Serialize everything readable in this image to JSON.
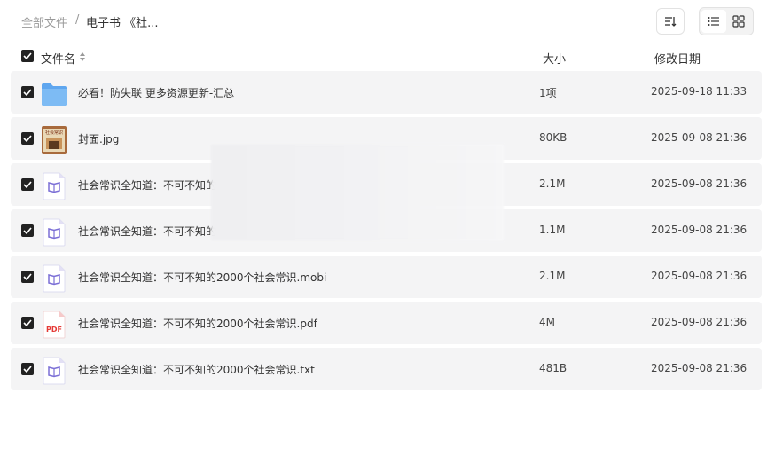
{
  "breadcrumb": {
    "root": "全部文件",
    "separator": "/",
    "current": "电子书 《社..."
  },
  "columns": {
    "name": "文件名",
    "size": "大小",
    "modified": "修改日期"
  },
  "files": [
    {
      "name": "必看！防失联 更多资源更新-汇总",
      "size": "1项",
      "modified": "2025-09-18 11:33",
      "icon": "folder-icon"
    },
    {
      "name": "封面.jpg",
      "size": "80KB",
      "modified": "2025-09-08 21:36",
      "icon": "image-thumbnail-icon"
    },
    {
      "name": "社会常识全知道：不可不知的",
      "size": "2.1M",
      "modified": "2025-09-08 21:36",
      "icon": "ebook-icon"
    },
    {
      "name": "社会常识全知道：不可不知的",
      "size": "1.1M",
      "modified": "2025-09-08 21:36",
      "icon": "ebook-icon"
    },
    {
      "name": "社会常识全知道：不可不知的2000个社会常识.mobi",
      "size": "2.1M",
      "modified": "2025-09-08 21:36",
      "icon": "ebook-icon"
    },
    {
      "name": "社会常识全知道：不可不知的2000个社会常识.pdf",
      "size": "4M",
      "modified": "2025-09-08 21:36",
      "icon": "pdf-icon"
    },
    {
      "name": "社会常识全知道：不可不知的2000个社会常识.txt",
      "size": "481B",
      "modified": "2025-09-08 21:36",
      "icon": "ebook-icon"
    }
  ],
  "icons": {
    "pdf_label": "PDF",
    "cover_text": "社会常识"
  },
  "colors": {
    "row_bg": "#f4f4f5",
    "checkbox": "#222222",
    "folder": "#6aaef0",
    "ebook": "#7b6fd6",
    "pdf": "#e53935"
  }
}
